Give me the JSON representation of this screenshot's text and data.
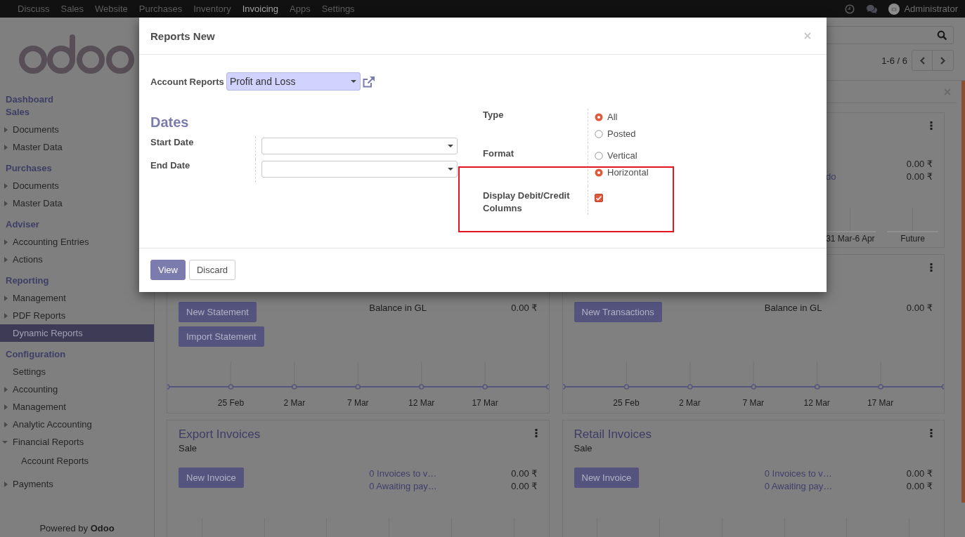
{
  "navbar": {
    "apps": [
      {
        "label": "Discuss",
        "selected": false
      },
      {
        "label": "Sales",
        "selected": false
      },
      {
        "label": "Website",
        "selected": false
      },
      {
        "label": "Purchases",
        "selected": false
      },
      {
        "label": "Inventory",
        "selected": false
      },
      {
        "label": "Invoicing",
        "selected": true
      },
      {
        "label": "Apps",
        "selected": false
      },
      {
        "label": "Settings",
        "selected": false
      }
    ],
    "user": {
      "name": "Administrator"
    }
  },
  "sidebar": {
    "sections": [
      {
        "title": "Dashboard"
      },
      {
        "title": "Sales",
        "items": [
          {
            "label": "Documents",
            "expanded": false,
            "selected": false
          },
          {
            "label": "Master Data",
            "expanded": false,
            "selected": false
          }
        ]
      },
      {
        "title": "Purchases",
        "items": [
          {
            "label": "Documents",
            "expanded": false,
            "selected": false
          },
          {
            "label": "Master Data",
            "expanded": false,
            "selected": false
          }
        ]
      },
      {
        "title": "Adviser",
        "items": [
          {
            "label": "Accounting Entries",
            "expanded": false,
            "selected": false
          },
          {
            "label": "Actions",
            "expanded": false,
            "selected": false
          }
        ]
      },
      {
        "title": "Reporting",
        "items": [
          {
            "label": "Management",
            "expanded": false,
            "selected": false
          },
          {
            "label": "PDF Reports",
            "expanded": false,
            "selected": false
          },
          {
            "label": "Dynamic Reports",
            "selected": true
          }
        ]
      },
      {
        "title": "Configuration",
        "items": [
          {
            "label": "Settings",
            "selected": false
          },
          {
            "label": "Accounting",
            "expanded": false,
            "selected": false
          },
          {
            "label": "Management",
            "expanded": false,
            "selected": false
          },
          {
            "label": "Analytic Accounting",
            "expanded": false,
            "selected": false
          },
          {
            "label": "Financial Reports",
            "expanded": true,
            "selected": false,
            "children": [
              {
                "label": "Account Reports",
                "selected": false
              }
            ]
          },
          {
            "label": "Payments",
            "expanded": false,
            "selected": false
          }
        ]
      }
    ],
    "footer": "Powered by **Odoo**"
  },
  "control_panel": {
    "pager": "1-6 / 6"
  },
  "dashboard": {
    "cards": [
      {
        "kind": "summary",
        "menu_icon": true,
        "stats": [
          {
            "amount": "0.00 ₹"
          },
          {
            "label": "do",
            "link": true,
            "amount": "0.00 ₹"
          }
        ],
        "chart": {
          "kind": "bar",
          "labels": [
            "31 Mar-6 Apr",
            "Future"
          ]
        }
      },
      {
        "kind": "journal",
        "buttons": [
          "New Statement",
          "Import Statement"
        ],
        "stats": [
          {
            "label": "Balance in GL",
            "link": false,
            "amount": "0.00 ₹"
          }
        ],
        "chart": {
          "kind": "line",
          "labels": [
            "25 Feb",
            "2 Mar",
            "7 Mar",
            "12 Mar",
            "17 Mar"
          ]
        }
      },
      {
        "kind": "journal",
        "menu_icon": true,
        "buttons": [
          "New Transactions"
        ],
        "stats": [
          {
            "label": "Balance in GL",
            "link": false,
            "amount": "0.00 ₹"
          }
        ],
        "chart": {
          "kind": "line",
          "labels": [
            "25 Feb",
            "2 Mar",
            "7 Mar",
            "12 Mar",
            "17 Mar"
          ]
        }
      },
      {
        "kind": "journal",
        "title": "Export Invoices",
        "subtitle": "Sale",
        "menu_icon": true,
        "buttons": [
          "New Invoice"
        ],
        "stats": [
          {
            "label": "0 Invoices to v…",
            "link": true,
            "amount": "0.00 ₹"
          },
          {
            "label": "0 Awaiting pay…",
            "link": true,
            "amount": "0.00 ₹"
          }
        ],
        "chart": {
          "kind": "bar"
        }
      },
      {
        "kind": "journal",
        "title": "Retail Invoices",
        "subtitle": "Sale",
        "menu_icon": true,
        "buttons": [
          "New Invoice"
        ],
        "stats": [
          {
            "label": "0 Invoices to v…",
            "link": true,
            "amount": "0.00 ₹"
          },
          {
            "label": "0 Awaiting pay…",
            "link": true,
            "amount": "0.00 ₹"
          }
        ],
        "chart": {
          "kind": "bar"
        }
      }
    ]
  },
  "dialog": {
    "title": "Reports New",
    "report": {
      "label": "Account Reports",
      "value": "Profit and Loss"
    },
    "dates": {
      "heading": "Dates",
      "fields": [
        {
          "label": "Start Date"
        },
        {
          "label": "End Date"
        }
      ]
    },
    "options": [
      {
        "kind": "radio",
        "label": "Type",
        "choices": [
          {
            "label": "All",
            "selected": true
          },
          {
            "label": "Posted",
            "selected": false
          }
        ]
      },
      {
        "kind": "radio",
        "label": "Format",
        "choices": [
          {
            "label": "Vertical",
            "selected": false
          },
          {
            "label": "Horizontal",
            "selected": true
          }
        ]
      },
      {
        "kind": "checkbox",
        "label": "Display Debit/Credit Columns",
        "checked": true
      }
    ],
    "buttons": [
      {
        "label": "View",
        "kind": "primary"
      },
      {
        "label": "Discard",
        "kind": "secondary"
      }
    ],
    "highlight": {
      "kind": "rectangle"
    }
  }
}
